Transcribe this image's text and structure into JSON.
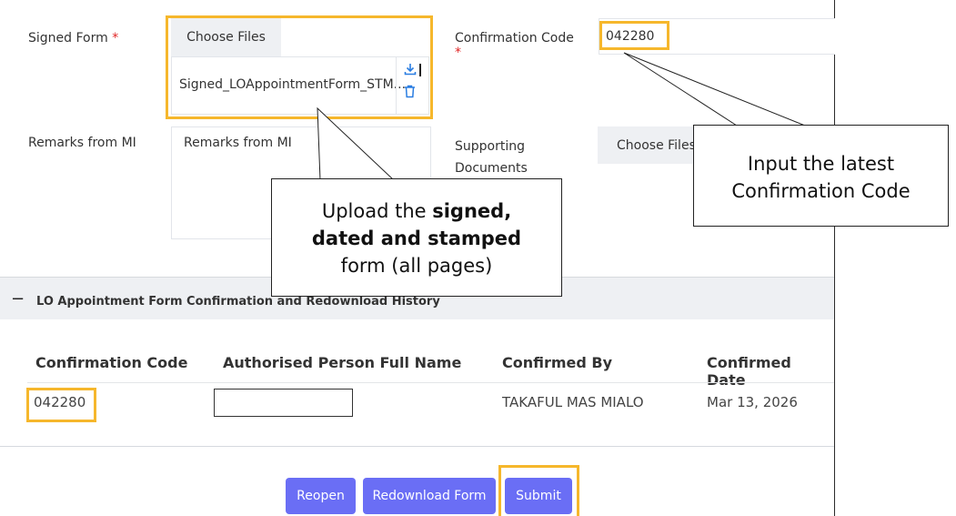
{
  "form": {
    "signed_form_label": "Signed Form",
    "required_mark": "*",
    "choose_files": "Choose Files",
    "file_name": "Signed_LOAppointmentForm_STM...",
    "confirmation_code_label": "Confirmation Code",
    "confirmation_code_value": "042280",
    "remarks_label": "Remarks from MI",
    "remarks_placeholder": "Remarks from MI",
    "supporting_label_line1": "Supporting",
    "supporting_label_line2": "Documents",
    "supporting_choose_files": "Choose Files"
  },
  "callouts": {
    "upload_prefix": "Upload the ",
    "upload_bold1": "signed,",
    "upload_bold2": "dated and stamped",
    "upload_suffix": "form (all pages)",
    "confirm_line1": "Input the latest",
    "confirm_line2": "Confirmation Code"
  },
  "history": {
    "collapse_icon": "−",
    "title": "LO Appointment Form Confirmation and Redownload History",
    "columns": [
      "Confirmation Code",
      "Authorised Person Full Name",
      "Confirmed By",
      "Confirmed Date"
    ],
    "row": {
      "code": "042280",
      "authorised_person": "",
      "confirmed_by": "TAKAFUL MAS MIALO",
      "confirmed_date": "Mar 13, 2026"
    }
  },
  "actions": {
    "reopen": "Reopen",
    "redownload": "Redownload Form",
    "submit": "Submit"
  },
  "colors": {
    "primary_button": "#6a6ef5",
    "highlight": "#f6b72c",
    "required": "#e02424"
  }
}
